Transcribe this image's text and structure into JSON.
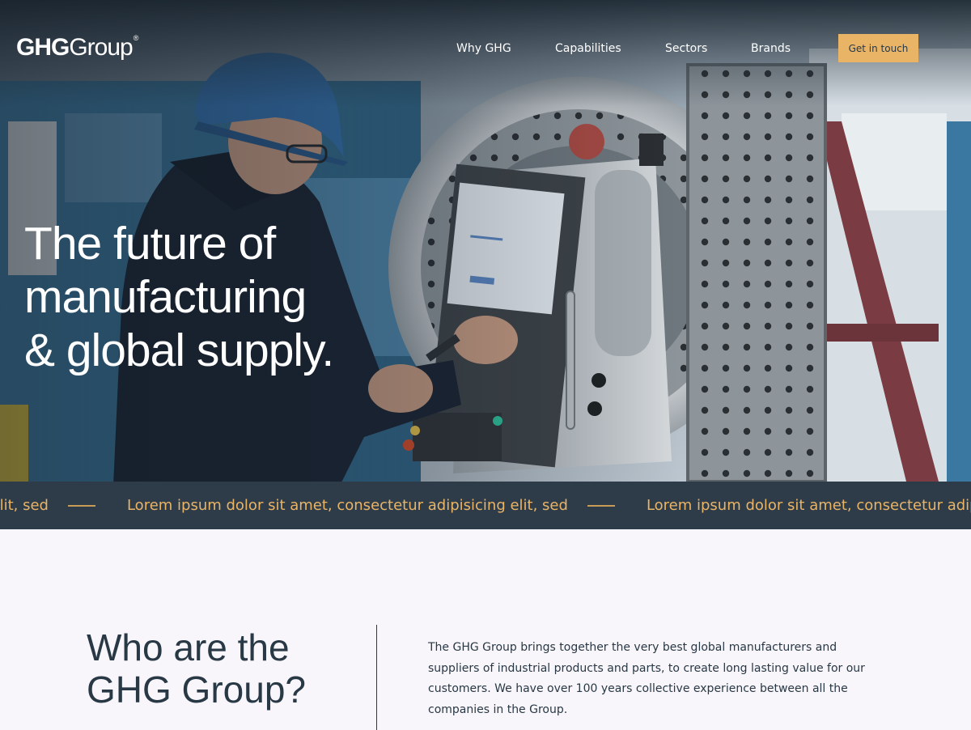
{
  "brand": {
    "logo_bold": "GHG",
    "logo_light": "Group",
    "logo_mark": "®"
  },
  "nav": {
    "items": [
      {
        "label": "Why GHG"
      },
      {
        "label": "Capabilities"
      },
      {
        "label": "Sectors"
      },
      {
        "label": "Brands"
      }
    ],
    "cta_label": "Get in touch"
  },
  "hero": {
    "headline_lines": [
      "The future of",
      "manufacturing",
      "& global supply."
    ]
  },
  "ticker": {
    "items": [
      "Lorem ipsum dolor sit amet, consectetur adipisicing elit, sed",
      "Lorem ipsum dolor sit amet, consectetur adipisicing elit, sed",
      "Lorem ipsum dolor sit amet, consectetur adipisicing elit, sed"
    ]
  },
  "about": {
    "title_lines": [
      "Who are the",
      "GHG Group?"
    ],
    "body": "The GHG Group brings together the very best global manufacturers and suppliers of industrial products and parts, to create long lasting value for our customers. We have over 100 years collective experience between all the companies in the Group."
  },
  "colors": {
    "accent": "#e9b466",
    "dark": "#283845",
    "ticker_bg": "#2e3c49",
    "page_bg": "#f8f6fb"
  }
}
